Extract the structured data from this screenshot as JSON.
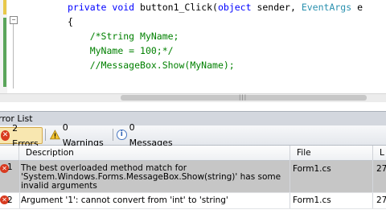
{
  "editor": {
    "code_line1": {
      "kw1": "private",
      "kw2": "void",
      "name": " button1_Click(",
      "kw3": "object",
      "mid": " sender, ",
      "type": "EventArgs",
      "tail": " e"
    },
    "code_line2": "{",
    "code_line3": "/*String MyName;",
    "code_line4": "MyName = 100;*/",
    "code_line5": "//MessageBox.Show(MyName);"
  },
  "panel": {
    "title": "rror List"
  },
  "toolbar": {
    "errors_label": "2 Errors",
    "warnings_label": "0 Warnings",
    "messages_label": "0 Messages"
  },
  "grid": {
    "headers": {
      "description": "Description",
      "file": "File",
      "line": "L"
    },
    "rows": [
      {
        "num": "1",
        "description": "The best overloaded method match for 'System.Windows.Forms.MessageBox.Show(string)' has some invalid arguments",
        "file": "Form1.cs",
        "line": "27"
      },
      {
        "num": "2",
        "description": "Argument '1': cannot convert from 'int' to 'string'",
        "file": "Form1.cs",
        "line": "27"
      }
    ]
  }
}
